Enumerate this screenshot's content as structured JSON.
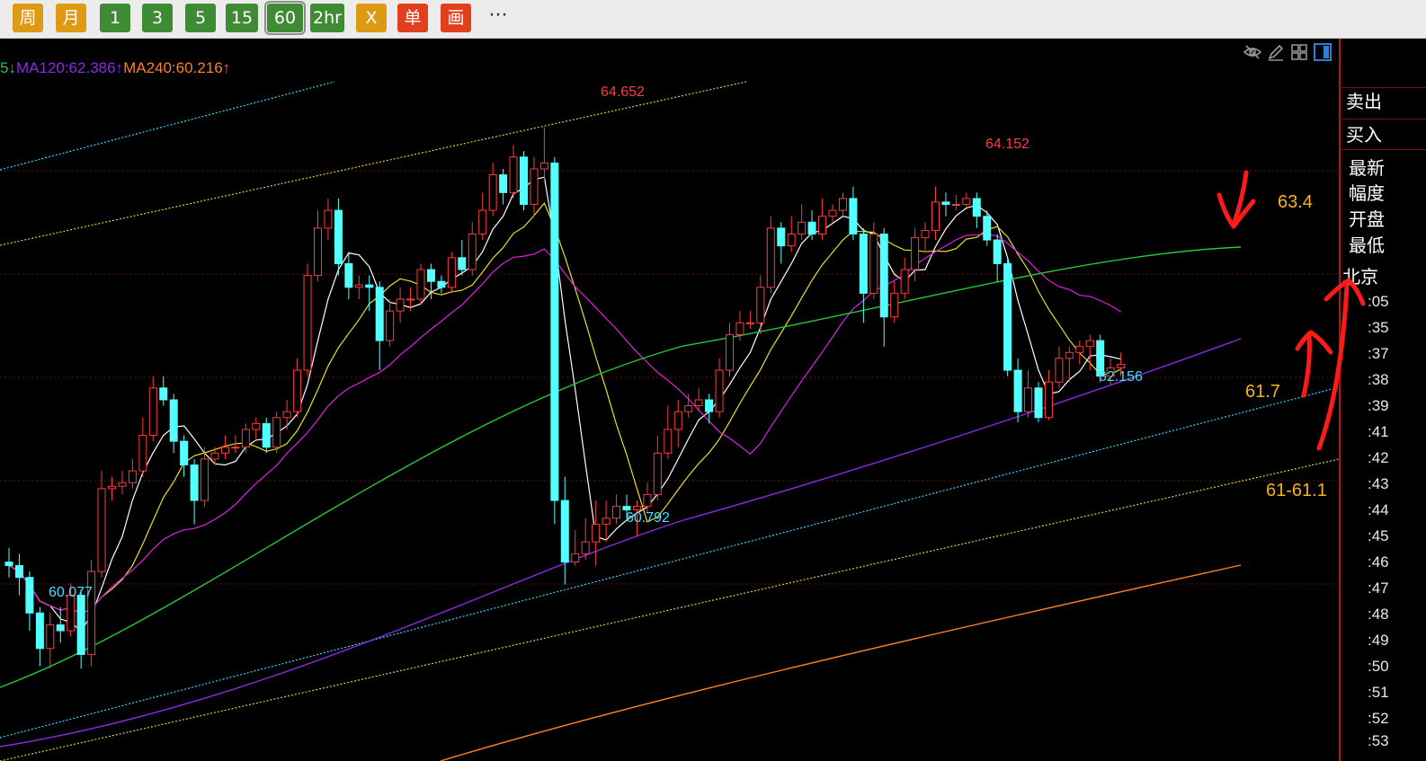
{
  "toolbar": {
    "buttons": [
      {
        "label": "周",
        "color": "#dd9a12"
      },
      {
        "label": "月",
        "color": "#dd9a12"
      },
      {
        "label": "1",
        "color": "#3f8a35"
      },
      {
        "label": "3",
        "color": "#3f8a35"
      },
      {
        "label": "5",
        "color": "#3f8a35"
      },
      {
        "label": "15",
        "color": "#3f8a35"
      },
      {
        "label": "60",
        "color": "#3f8a35",
        "selected": true
      },
      {
        "label": "2hr",
        "color": "#3f8a35"
      },
      {
        "label": "X",
        "color": "#dd9a12"
      },
      {
        "label": "单",
        "color": "#e0401b"
      },
      {
        "label": "画",
        "color": "#e0401b"
      }
    ],
    "more": "···"
  },
  "ma_legend": {
    "ma_prev_tail": "5↓",
    "ma120": "MA120:62.386↑",
    "ma240": "MA240:60.216↑",
    "colors": {
      "prev": "#22c93a",
      "ma120": "#8a2be2",
      "ma240": "#ff7f27"
    }
  },
  "side_panel": {
    "sell": "卖出",
    "buy": "买入",
    "latest": "最新",
    "range": "幅度",
    "open": "开盘",
    "low": "最低",
    "market": "北京",
    "times": [
      ":05",
      ":35",
      ":37",
      ":38",
      ":39",
      ":41",
      ":42",
      ":43",
      ":44",
      ":45",
      ":46",
      ":47",
      ":48",
      ":49",
      ":50",
      ":51",
      ":52",
      ":53"
    ]
  },
  "icons": [
    "eye-slash-icon",
    "pencil-icon",
    "grid-icon",
    "panel-toggle-icon"
  ],
  "annotations": {
    "resistance": "63.4",
    "support1": "61.7",
    "support2": "61-61.1",
    "color": "#f4b41a",
    "mark_color": "#ff1a1a"
  },
  "chart_data": {
    "type": "candlestick",
    "ylim": [
      59.3,
      65.4
    ],
    "price_labels": [
      {
        "value": 64.652,
        "text": "64.652",
        "color": "#ff3b3b"
      },
      {
        "value": 64.152,
        "text": "64.152",
        "color": "#ff3b3b"
      },
      {
        "value": 62.156,
        "text": "62.156",
        "color": "#40e0ff"
      },
      {
        "value": 60.792,
        "text": "60.792",
        "color": "#40e0ff"
      },
      {
        "value": 60.077,
        "text": "60.077",
        "color": "#40e0ff"
      }
    ],
    "candles": [
      [
        60.98,
        60.95,
        61.1,
        60.85
      ],
      [
        60.95,
        60.85,
        61.05,
        60.7
      ],
      [
        60.85,
        60.55,
        60.9,
        60.4
      ],
      [
        60.55,
        60.25,
        60.6,
        60.1
      ],
      [
        60.25,
        60.45,
        60.55,
        60.08
      ],
      [
        60.45,
        60.4,
        60.6,
        60.3
      ],
      [
        60.4,
        60.7,
        60.8,
        60.35
      ],
      [
        60.7,
        60.2,
        60.75,
        60.08
      ],
      [
        60.2,
        60.9,
        61.0,
        60.1
      ],
      [
        60.9,
        61.6,
        61.75,
        60.85
      ],
      [
        61.6,
        61.62,
        61.7,
        61.5
      ],
      [
        61.62,
        61.65,
        61.75,
        61.55
      ],
      [
        61.65,
        61.75,
        61.85,
        61.6
      ],
      [
        61.75,
        62.05,
        62.2,
        61.7
      ],
      [
        62.05,
        62.45,
        62.55,
        62.0
      ],
      [
        62.45,
        62.35,
        62.55,
        62.3
      ],
      [
        62.35,
        62.0,
        62.4,
        61.9
      ],
      [
        62.0,
        61.8,
        62.05,
        61.7
      ],
      [
        61.8,
        61.5,
        61.85,
        61.3
      ],
      [
        61.5,
        61.85,
        61.95,
        61.45
      ],
      [
        61.85,
        61.9,
        61.95,
        61.8
      ],
      [
        61.9,
        61.95,
        62.05,
        61.85
      ],
      [
        61.95,
        61.95,
        62.05,
        61.9
      ],
      [
        61.95,
        62.1,
        62.15,
        61.9
      ],
      [
        62.1,
        62.15,
        62.2,
        62.0
      ],
      [
        62.15,
        61.95,
        62.2,
        61.9
      ],
      [
        61.95,
        62.2,
        62.25,
        61.9
      ],
      [
        62.2,
        62.25,
        62.35,
        62.1
      ],
      [
        62.25,
        62.6,
        62.7,
        62.2
      ],
      [
        62.6,
        63.4,
        63.5,
        62.55
      ],
      [
        63.4,
        63.8,
        63.95,
        63.35
      ],
      [
        63.8,
        63.95,
        64.05,
        63.7
      ],
      [
        63.95,
        63.5,
        64.05,
        63.4
      ],
      [
        63.5,
        63.3,
        63.6,
        63.2
      ],
      [
        63.3,
        63.32,
        63.4,
        63.2
      ],
      [
        63.32,
        63.3,
        63.4,
        63.1
      ],
      [
        63.3,
        62.85,
        63.35,
        62.6
      ],
      [
        62.85,
        63.1,
        63.2,
        62.8
      ],
      [
        63.1,
        63.2,
        63.3,
        63.0
      ],
      [
        63.2,
        63.2,
        63.3,
        63.1
      ],
      [
        63.2,
        63.45,
        63.5,
        63.15
      ],
      [
        63.45,
        63.35,
        63.5,
        63.2
      ],
      [
        63.35,
        63.3,
        63.4,
        63.25
      ],
      [
        63.3,
        63.55,
        63.6,
        63.25
      ],
      [
        63.55,
        63.45,
        63.7,
        63.4
      ],
      [
        63.45,
        63.75,
        63.85,
        63.4
      ],
      [
        63.75,
        63.95,
        64.1,
        63.7
      ],
      [
        63.95,
        64.25,
        64.35,
        63.9
      ],
      [
        64.25,
        64.1,
        64.3,
        64.0
      ],
      [
        64.1,
        64.4,
        64.5,
        64.05
      ],
      [
        64.4,
        64.0,
        64.45,
        63.95
      ],
      [
        64.0,
        64.3,
        64.4,
        63.9
      ],
      [
        64.3,
        64.35,
        64.65,
        64.2
      ],
      [
        64.35,
        61.5,
        64.4,
        61.3
      ],
      [
        61.5,
        60.98,
        61.7,
        60.79
      ],
      [
        60.98,
        61.05,
        61.25,
        60.95
      ],
      [
        61.05,
        61.15,
        61.35,
        61.0
      ],
      [
        61.15,
        61.3,
        61.5,
        60.95
      ],
      [
        61.3,
        61.35,
        61.5,
        61.15
      ],
      [
        61.35,
        61.45,
        61.55,
        61.3
      ],
      [
        61.45,
        61.42,
        61.55,
        61.35
      ],
      [
        61.42,
        61.45,
        61.5,
        61.2
      ],
      [
        61.45,
        61.55,
        61.65,
        61.4
      ],
      [
        61.55,
        61.9,
        62.05,
        61.5
      ],
      [
        61.9,
        62.1,
        62.3,
        61.85
      ],
      [
        62.1,
        62.25,
        62.35,
        61.95
      ],
      [
        62.25,
        62.3,
        62.4,
        62.2
      ],
      [
        62.3,
        62.35,
        62.45,
        62.25
      ],
      [
        62.35,
        62.25,
        62.4,
        62.15
      ],
      [
        62.25,
        62.6,
        62.7,
        62.2
      ],
      [
        62.6,
        62.9,
        63.0,
        62.55
      ],
      [
        62.9,
        63.0,
        63.1,
        62.85
      ],
      [
        63.0,
        63.0,
        63.1,
        62.95
      ],
      [
        63.0,
        63.3,
        63.4,
        62.9
      ],
      [
        63.3,
        63.8,
        63.9,
        63.25
      ],
      [
        63.8,
        63.65,
        63.85,
        63.5
      ],
      [
        63.65,
        63.75,
        63.9,
        63.6
      ],
      [
        63.75,
        63.85,
        64.0,
        63.7
      ],
      [
        63.85,
        63.75,
        63.95,
        63.7
      ],
      [
        63.75,
        63.9,
        64.05,
        63.7
      ],
      [
        63.9,
        63.95,
        64.0,
        63.85
      ],
      [
        63.95,
        64.05,
        64.1,
        63.9
      ],
      [
        64.05,
        63.75,
        64.15,
        63.7
      ],
      [
        63.75,
        63.25,
        63.8,
        63.0
      ],
      [
        63.25,
        63.75,
        63.85,
        63.2
      ],
      [
        63.75,
        63.05,
        63.8,
        62.8
      ],
      [
        63.05,
        63.25,
        63.35,
        63.0
      ],
      [
        63.25,
        63.45,
        63.55,
        63.2
      ],
      [
        63.45,
        63.72,
        63.8,
        63.35
      ],
      [
        63.72,
        63.78,
        63.85,
        63.6
      ],
      [
        63.78,
        64.02,
        64.15,
        63.7
      ],
      [
        64.02,
        64.0,
        64.1,
        63.9
      ],
      [
        64.0,
        64.0,
        64.08,
        63.95
      ],
      [
        64.0,
        64.05,
        64.1,
        63.98
      ],
      [
        64.05,
        63.9,
        64.1,
        63.8
      ],
      [
        63.9,
        63.7,
        63.95,
        63.65
      ],
      [
        63.7,
        63.5,
        63.75,
        63.35
      ],
      [
        63.5,
        62.6,
        63.55,
        62.55
      ],
      [
        62.6,
        62.25,
        62.7,
        62.16
      ],
      [
        62.25,
        62.45,
        62.6,
        62.2
      ],
      [
        62.45,
        62.2,
        62.5,
        62.16
      ],
      [
        62.2,
        62.5,
        62.6,
        62.18
      ],
      [
        62.5,
        62.7,
        62.8,
        62.45
      ],
      [
        62.7,
        62.75,
        62.8,
        62.5
      ],
      [
        62.75,
        62.8,
        62.85,
        62.65
      ],
      [
        62.8,
        62.85,
        62.9,
        62.6
      ],
      [
        62.85,
        62.55,
        62.9,
        62.5
      ],
      [
        62.55,
        62.62,
        62.7,
        62.48
      ],
      [
        62.62,
        62.65,
        62.75,
        62.55
      ]
    ]
  }
}
